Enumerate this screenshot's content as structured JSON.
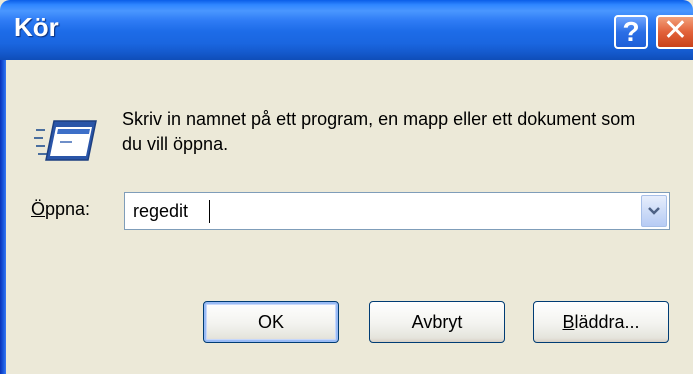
{
  "window": {
    "title": "Kör",
    "help_label": "?",
    "close_label": "✕"
  },
  "dialog": {
    "description": "Skriv in namnet på ett program, en mapp eller ett dokument som du vill öppna.",
    "open_label_accel": "Ö",
    "open_label_rest": "ppna:",
    "open_value": "regedit"
  },
  "buttons": {
    "ok": "OK",
    "cancel": "Avbryt",
    "browse_accel": "B",
    "browse_rest": "läddra..."
  },
  "icons": {
    "run": "run-program-icon",
    "dropdown": "chevron-down-icon"
  },
  "colors": {
    "titlebar": "#1d6ce8",
    "close": "#e2623a",
    "face": "#ece9d8"
  }
}
